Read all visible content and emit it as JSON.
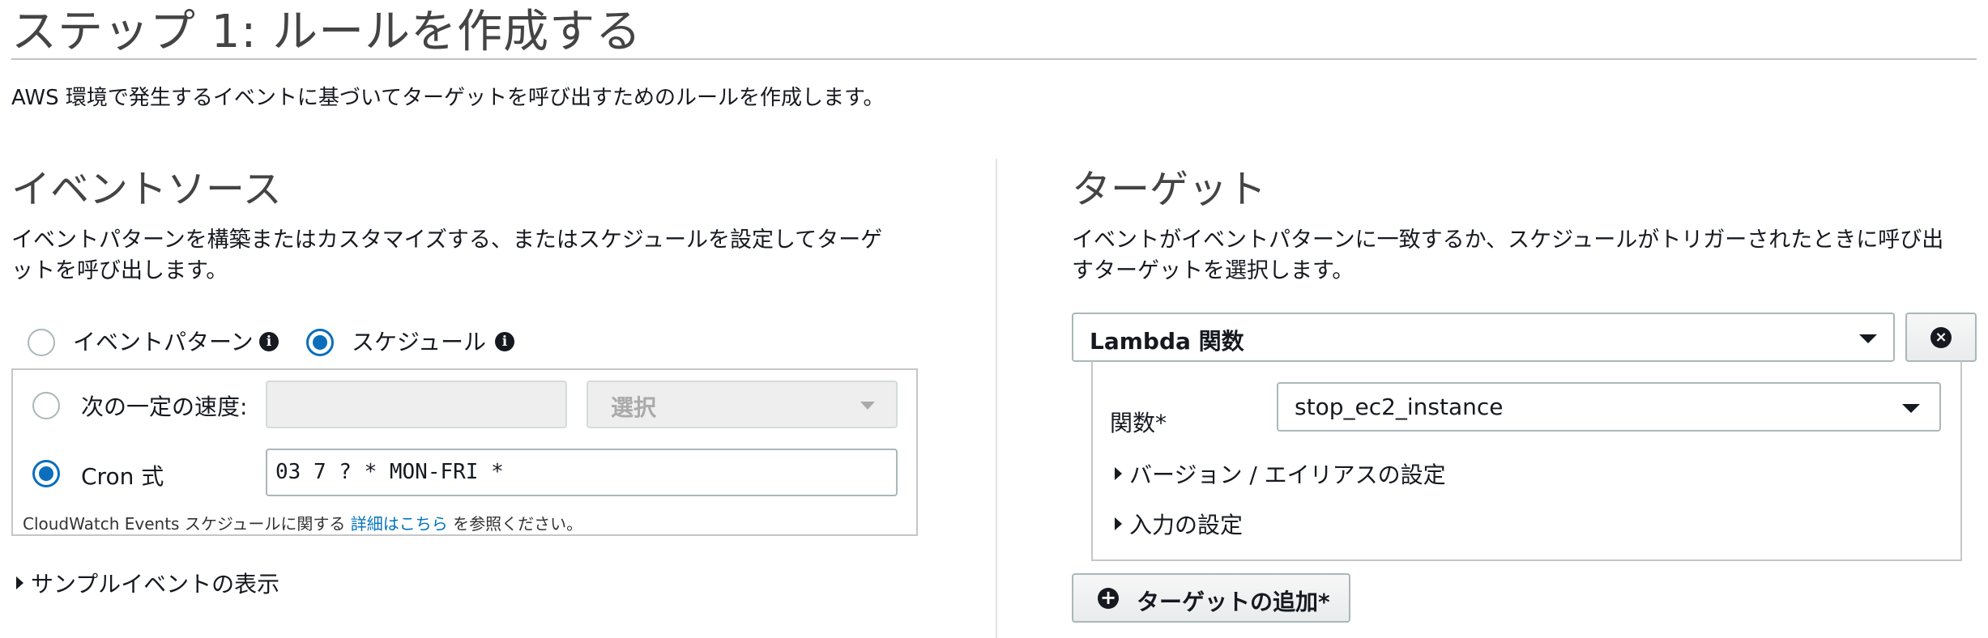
{
  "page": {
    "title": "ステップ 1: ルールを作成する",
    "description": "AWS 環境で発生するイベントに基づいてターゲットを呼び出すためのルールを作成します。"
  },
  "event_source": {
    "heading": "イベントソース",
    "description_line1": "イベントパターンを構築またはカスタマイズする、またはスケジュールを設定してターゲ",
    "description_line2": "ットを呼び出します。",
    "option_event_pattern": "イベントパターン",
    "option_schedule": "スケジュール",
    "selected_option": "スケジュール",
    "info_glyph": "i",
    "fixed_rate": {
      "label": "次の一定の速度:",
      "value": "",
      "unit_select": "選択"
    },
    "cron": {
      "label": "Cron 式",
      "value": "03 7 ? * MON-FRI *"
    },
    "help_prefix": "CloudWatch Events スケジュールに関する",
    "help_link": "詳細はこちら",
    "help_suffix": "を参照ください。",
    "sample_event_toggle": "サンプルイベントの表示"
  },
  "targets": {
    "heading": "ターゲット",
    "description_line1": "イベントがイベントパターンに一致するか、スケジュールがトリガーされたときに呼び出",
    "description_line2": "すターゲットを選択します。",
    "target_type": "Lambda 関数",
    "remove_glyph": "×",
    "function_label": "関数*",
    "function_value": "stop_ec2_instance",
    "version_alias_toggle": "バージョン / エイリアスの設定",
    "input_config_toggle": "入力の設定",
    "add_target_label": "ターゲットの追加*",
    "add_glyph": "+"
  },
  "colors": {
    "accent_blue": "#0a6ebd",
    "link_blue": "#0073bb",
    "border_gray": "#aab7b8"
  },
  "icons": [
    "info-icon",
    "caret-down-icon",
    "remove-icon",
    "plus-circle-icon",
    "caret-right-icon"
  ]
}
